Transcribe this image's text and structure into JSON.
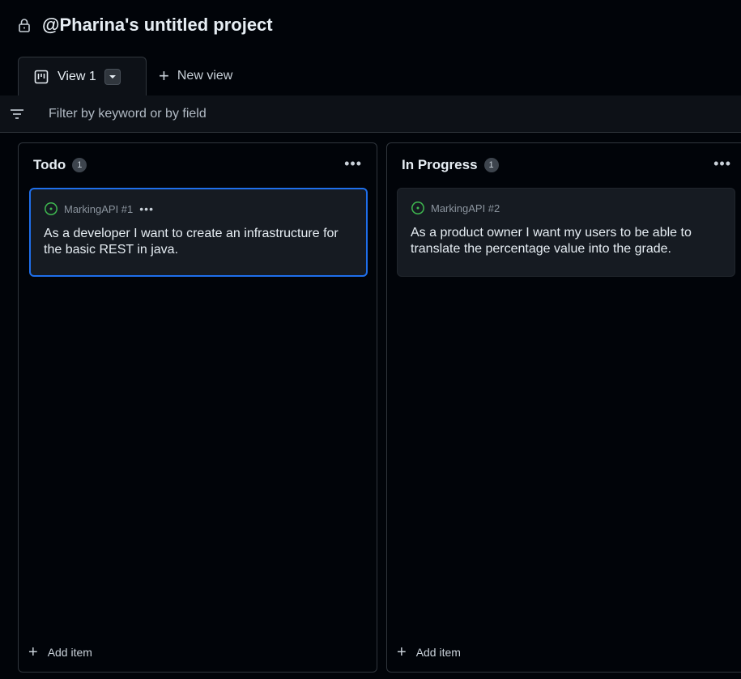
{
  "header": {
    "title": "@Pharina's untitled project",
    "icon": "lock-icon"
  },
  "tabs": {
    "active": {
      "label": "View 1",
      "icon": "board-icon"
    },
    "new_view_label": "New view"
  },
  "filter": {
    "placeholder": "Filter by keyword or by field",
    "value": "",
    "icon": "filter-icon"
  },
  "columns": [
    {
      "title": "Todo",
      "count": "1",
      "add_item_label": "Add item",
      "cards": [
        {
          "ref": "MarkingAPI #1",
          "title": "As a developer I want to create an infrastructure for the basic REST in java.",
          "status_color": "#3fb950",
          "selected": true
        }
      ]
    },
    {
      "title": "In Progress",
      "count": "1",
      "add_item_label": "Add item",
      "cards": [
        {
          "ref": "MarkingAPI #2",
          "title": "As a product owner I want my users to be able to translate the percentage value into the grade.",
          "status_color": "#3fb950",
          "selected": false
        }
      ]
    }
  ],
  "colors": {
    "background": "#010409",
    "accent": "#1f6feb",
    "open_issue": "#3fb950"
  }
}
